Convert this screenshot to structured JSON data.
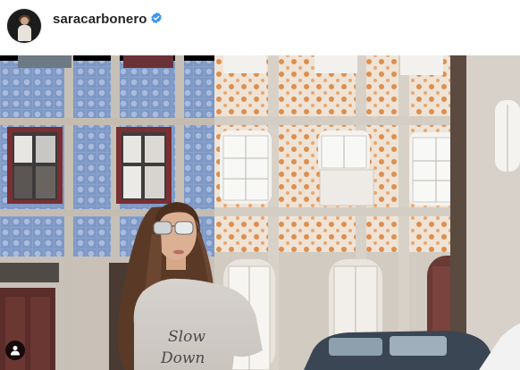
{
  "post": {
    "username": "saracarbonero",
    "verified": true,
    "colors": {
      "verified_badge": "#3897f0",
      "text": "#262626"
    },
    "icons": {
      "avatar": "profile-avatar",
      "verified": "verified-badge-icon",
      "tagged_users": "user-tag-icon"
    }
  }
}
